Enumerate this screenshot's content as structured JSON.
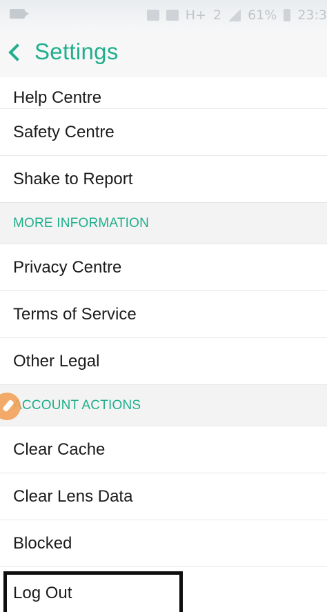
{
  "status_bar": {
    "battery_percent": "61%",
    "time": "23:3",
    "network": "H+",
    "sim_badge": "2",
    "icons": [
      "video-icon",
      "cast-icon",
      "mute-icon",
      "signal-icon",
      "battery-icon"
    ]
  },
  "header": {
    "back_icon": "chevron-left-icon",
    "title": "Settings"
  },
  "list": {
    "help_centre": "Help Centre",
    "safety_centre": "Safety Centre",
    "shake_to_report": "Shake to Report",
    "more_information": "MORE INFORMATION",
    "privacy_centre": "Privacy Centre",
    "terms_of_service": "Terms of Service",
    "other_legal": "Other Legal",
    "account_actions": "ACCOUNT ACTIONS",
    "clear_cache": "Clear Cache",
    "clear_lens_data": "Clear Lens Data",
    "blocked": "Blocked",
    "log_out": "Log Out"
  },
  "colors": {
    "accent": "#1faf8d",
    "section_bg": "#f3f3f3",
    "text": "#1b1b1b",
    "highlight_box": "#0e0e0e",
    "touch_indicator": "#f3a35a"
  }
}
